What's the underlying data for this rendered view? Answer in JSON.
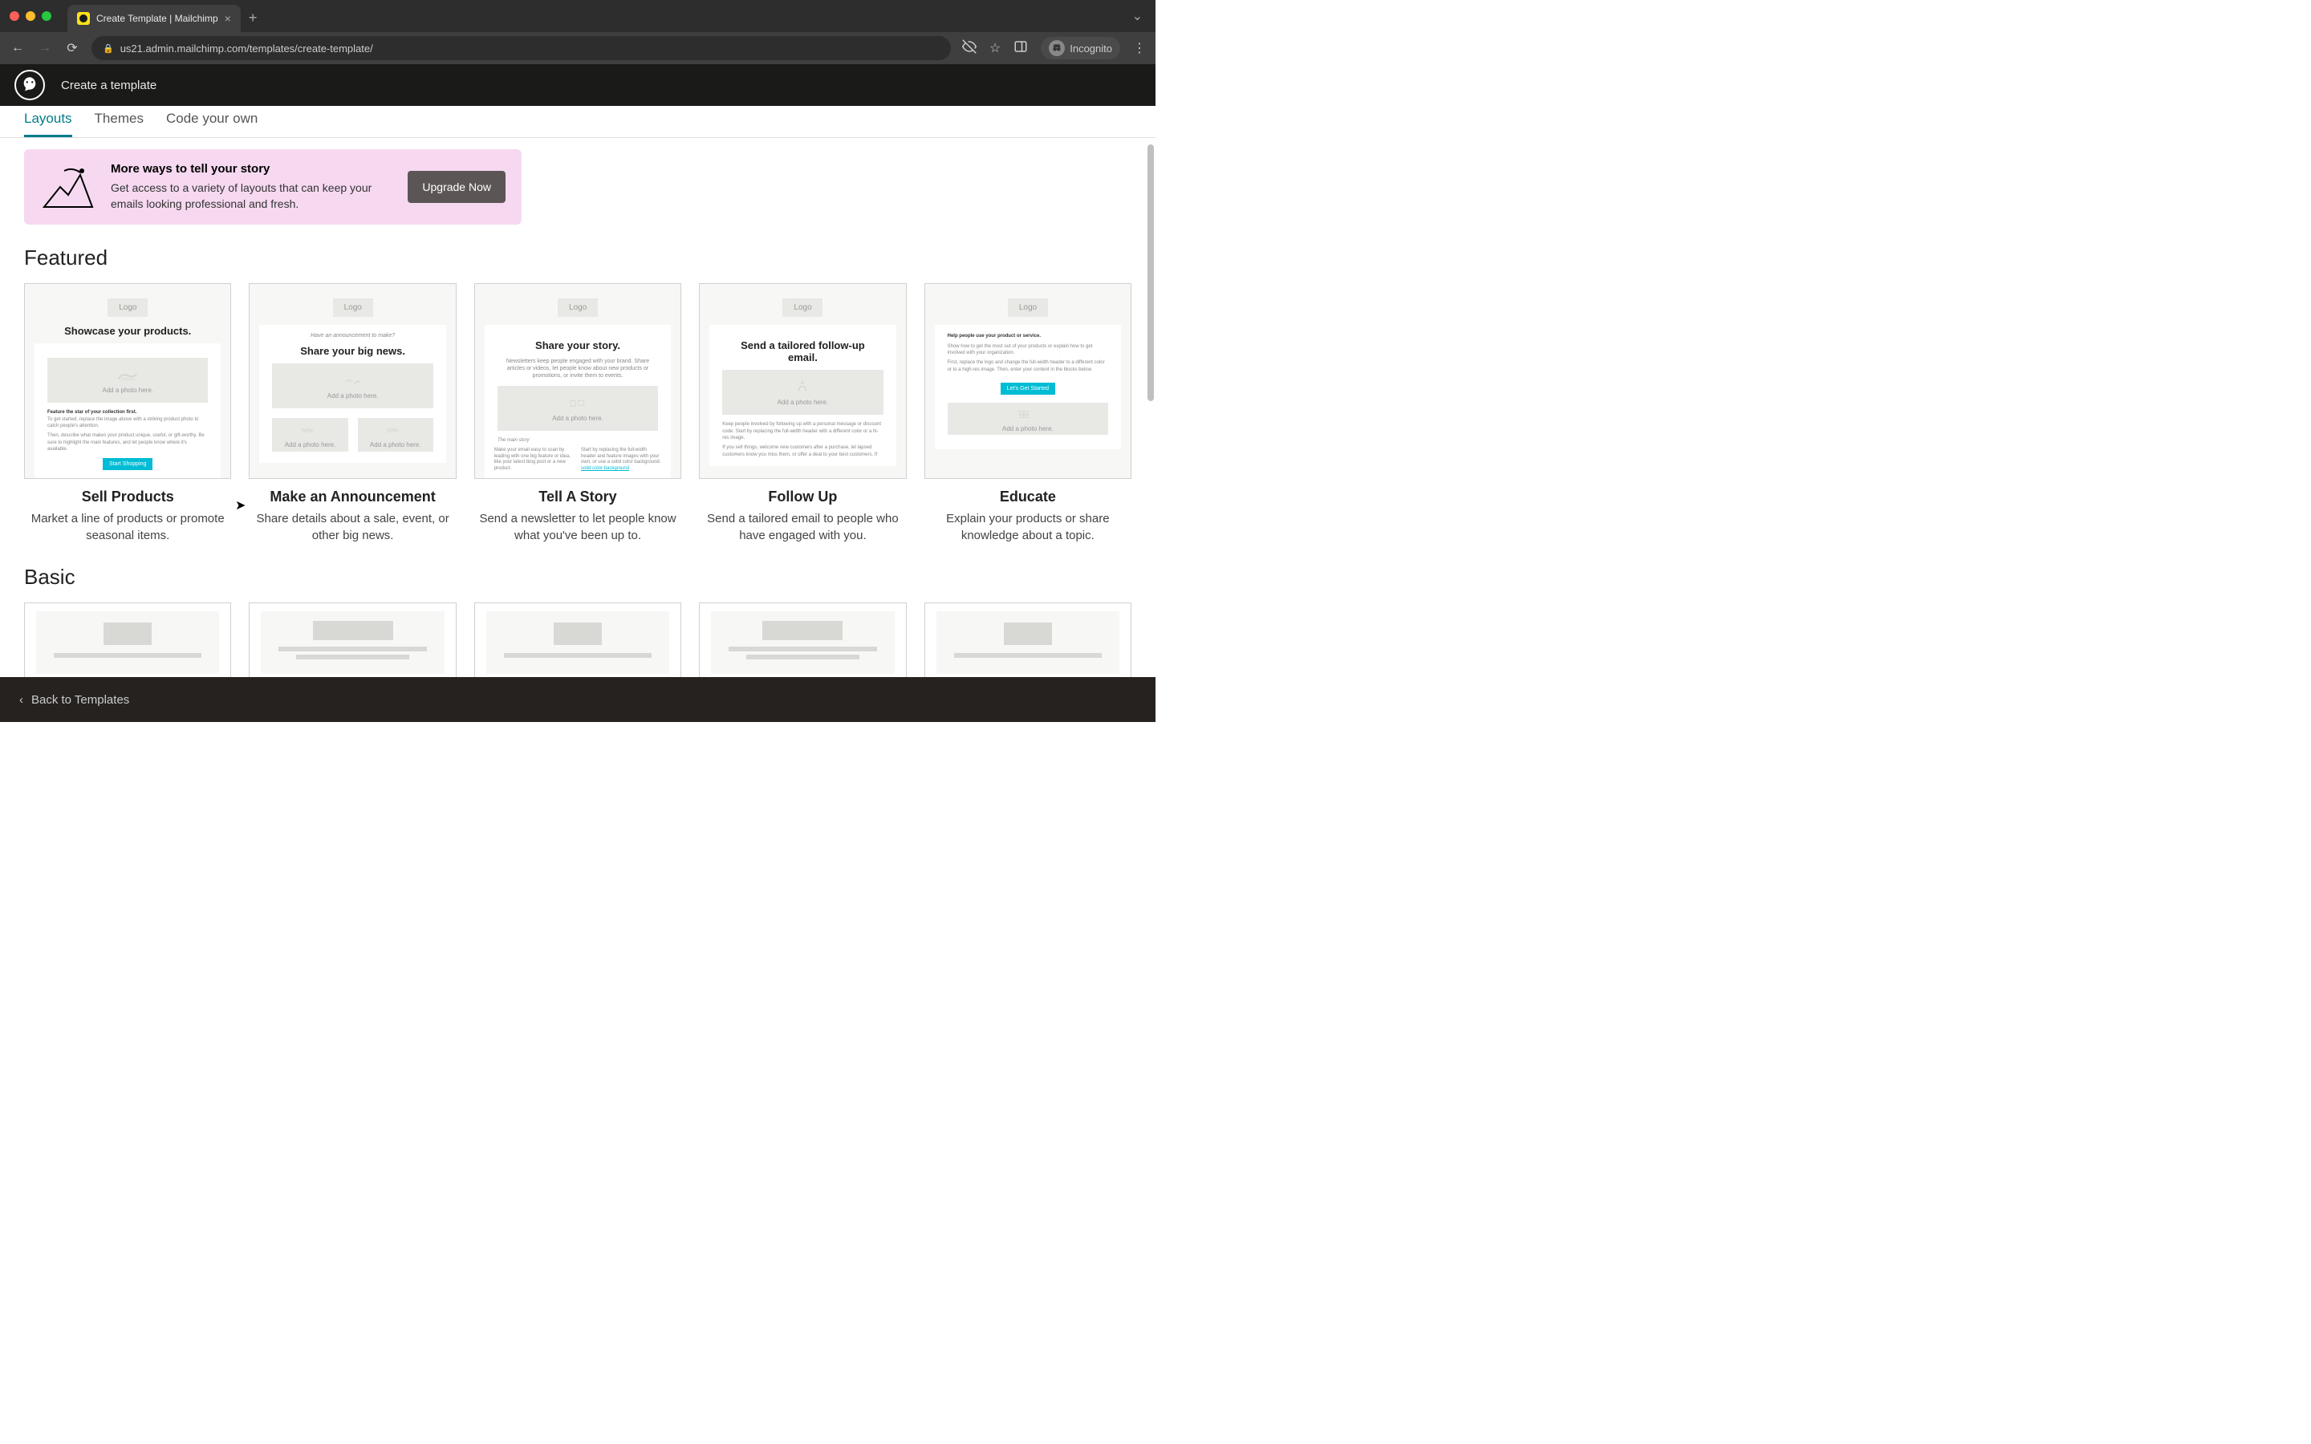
{
  "browser": {
    "tab_title": "Create Template | Mailchimp",
    "url": "us21.admin.mailchimp.com/templates/create-template/",
    "incognito_label": "Incognito"
  },
  "header": {
    "title": "Create a template"
  },
  "tabs": {
    "layouts": "Layouts",
    "themes": "Themes",
    "code": "Code your own"
  },
  "promo": {
    "title": "More ways to tell your story",
    "desc": "Get access to a variety of layouts that can keep your emails looking professional and fresh.",
    "button": "Upgrade Now"
  },
  "sections": {
    "featured": "Featured",
    "basic": "Basic"
  },
  "featured": [
    {
      "name": "Sell Products",
      "desc": "Market a line of products or promote seasonal items.",
      "preview": {
        "logo": "Logo",
        "headline": "Showcase your products.",
        "photo_label": "Add a photo here.",
        "body_title": "Feature the star of your collection first.",
        "body1": "To get started, replace the image above with a striking product photo to catch people's attention.",
        "body2": "Then, describe what makes your product unique, useful, or gift-worthy. Be sure to highlight the main features, and let people know where it's available.",
        "cta": "Start Shopping"
      }
    },
    {
      "name": "Make an Announcement",
      "desc": "Share details about a sale, event, or other big news.",
      "preview": {
        "logo": "Logo",
        "sub": "Have an announcement to make?",
        "headline": "Share your big news.",
        "photo_label": "Add a photo here."
      }
    },
    {
      "name": "Tell A Story",
      "desc": "Send a newsletter to let people know what you've been up to.",
      "preview": {
        "logo": "Logo",
        "headline": "Share your story.",
        "tiny": "Newsletters keep people engaged with your brand. Share articles or videos, let people know about new products or promotions, or invite them to events.",
        "photo_label": "Add a photo here.",
        "col_title": "The main story",
        "col1": "Make your email easy to scan by leading with one big feature or idea, like your latest blog post or a new product.",
        "col2": "Start by replacing the full-width header and feature images with your own, or use a solid color background."
      }
    },
    {
      "name": "Follow Up",
      "desc": "Send a tailored email to people who have engaged with you.",
      "preview": {
        "logo": "Logo",
        "headline": "Send a tailored follow-up email.",
        "photo_label": "Add a photo here.",
        "body": "Keep people involved by following up with a personal message or discount code. Start by replacing the full-width header with a different color or a hi-res image.",
        "body2": "If you sell things, welcome new customers after a purchase, let lapsed customers know you miss them, or offer a deal to your best customers. If"
      }
    },
    {
      "name": "Educate",
      "desc": "Explain your products or share knowledge about a topic.",
      "preview": {
        "logo": "Logo",
        "headline": "Help people use your product or service.",
        "body1": "Show how to get the most out of your products or explain how to get involved with your organization.",
        "body2": "First, replace the logo and change the full-width header to a different color or to a high-res image. Then, enter your content in the blocks below.",
        "cta": "Let's Get Started",
        "photo_label": "Add a photo here."
      }
    }
  ],
  "footer": {
    "back": "Back to Templates"
  }
}
